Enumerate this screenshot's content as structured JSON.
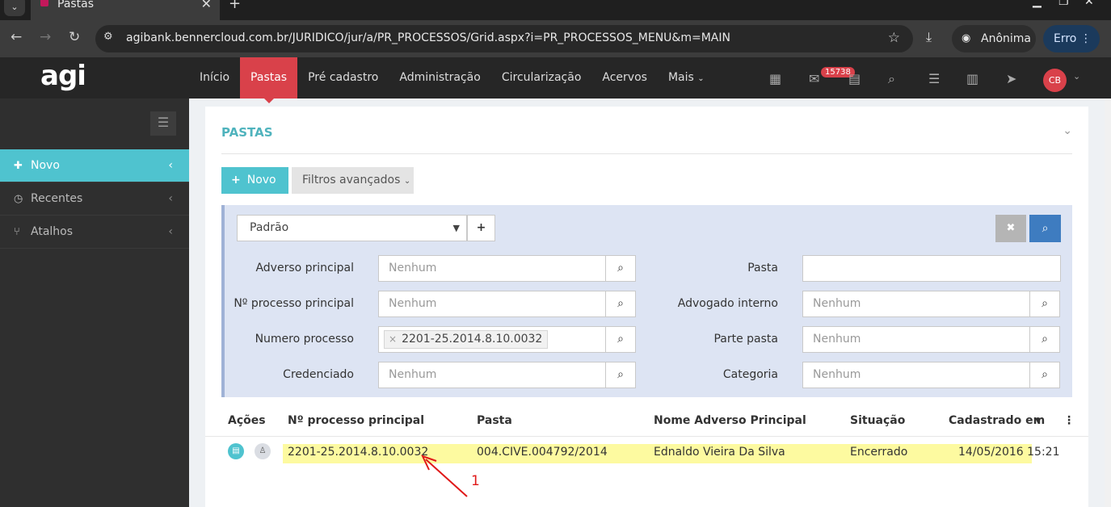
{
  "browser": {
    "tab_title": "Pastas",
    "url": "agibank.bennercloud.com.br/JURIDICO/jur/a/PR_PROCESSOS/Grid.aspx?i=PR_PROCESSOS_MENU&m=MAIN",
    "profile_label": "Anônima",
    "error_label": "Erro"
  },
  "app": {
    "logo": "agi",
    "menu": [
      "Início",
      "Pastas",
      "Pré cadastro",
      "Administração",
      "Circularização",
      "Acervos",
      "Mais"
    ],
    "active_menu": "Pastas",
    "notification_count": "15738",
    "user_initials": "CB",
    "accent_color": "#4fc3cf",
    "brand_color": "#d9414a"
  },
  "sidebar": {
    "items": [
      {
        "label": "Novo",
        "icon": "plus-icon",
        "active": true
      },
      {
        "label": "Recentes",
        "icon": "clock-icon",
        "active": false
      },
      {
        "label": "Atalhos",
        "icon": "branch-icon",
        "active": false
      }
    ]
  },
  "page": {
    "title": "PASTAS",
    "novo_label": "Novo",
    "filtros_label": "Filtros avançados"
  },
  "filters": {
    "preset": "Padrão",
    "left": [
      {
        "label": "Adverso principal",
        "value": "",
        "placeholder": "Nenhum"
      },
      {
        "label": "Nº processo principal",
        "value": "",
        "placeholder": "Nenhum"
      },
      {
        "label": "Numero processo",
        "value": "2201-25.2014.8.10.0032",
        "placeholder": ""
      },
      {
        "label": "Credenciado",
        "value": "",
        "placeholder": "Nenhum"
      }
    ],
    "right": [
      {
        "label": "Pasta",
        "value": "",
        "placeholder": ""
      },
      {
        "label": "Advogado interno",
        "value": "",
        "placeholder": "Nenhum"
      },
      {
        "label": "Parte pasta",
        "value": "",
        "placeholder": "Nenhum"
      },
      {
        "label": "Categoria",
        "value": "",
        "placeholder": "Nenhum"
      }
    ]
  },
  "grid": {
    "columns": [
      "Ações",
      "Nº processo principal",
      "Pasta",
      "Nome Adverso Principal",
      "Situação",
      "Cadastrado em"
    ],
    "rows": [
      {
        "processo": "2201-25.2014.8.10.0032",
        "pasta": "004.CIVE.004792/2014",
        "adverso": "Ednaldo Vieira Da Silva",
        "situacao": "Encerrado",
        "cadastrado": "14/05/2016 15:21"
      }
    ]
  },
  "annotation": {
    "label": "1"
  }
}
